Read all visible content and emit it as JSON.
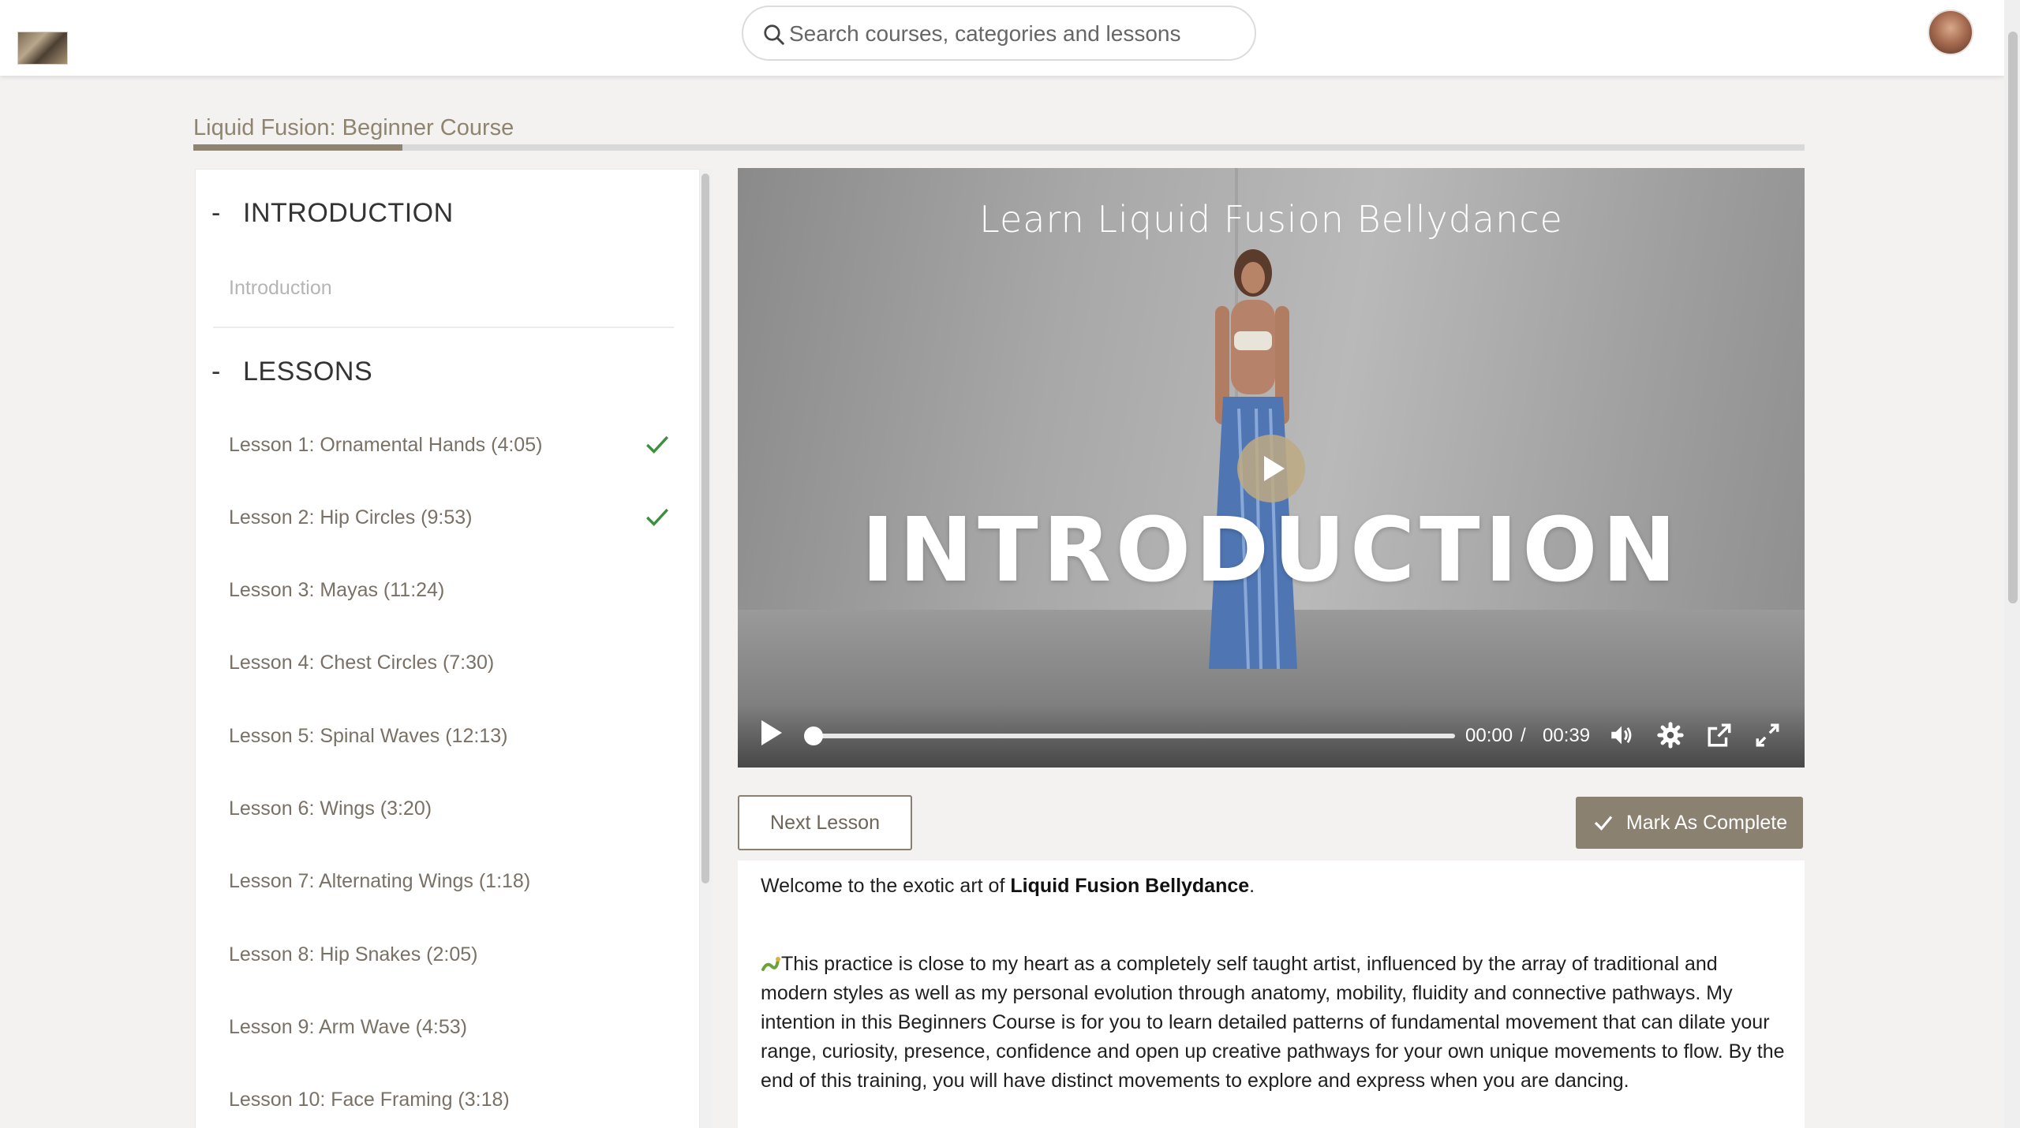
{
  "header": {
    "search_placeholder": "Search courses, categories and lessons"
  },
  "course": {
    "title": "Liquid Fusion: Beginner Course",
    "progress_percent": 13
  },
  "sidebar": {
    "sections": [
      {
        "dash": "-",
        "title": "INTRODUCTION"
      },
      {
        "dash": "-",
        "title": "LESSONS"
      }
    ],
    "intro_item": "Introduction",
    "lessons": [
      {
        "label": "Lesson 1: Ornamental Hands (4:05)",
        "completed": true
      },
      {
        "label": "Lesson 2: Hip Circles (9:53)",
        "completed": true
      },
      {
        "label": "Lesson 3: Mayas (11:24)",
        "completed": false
      },
      {
        "label": "Lesson 4: Chest Circles (7:30)",
        "completed": false
      },
      {
        "label": "Lesson 5: Spinal Waves (12:13)",
        "completed": false
      },
      {
        "label": "Lesson 6: Wings (3:20)",
        "completed": false
      },
      {
        "label": "Lesson 7: Alternating Wings (1:18)",
        "completed": false
      },
      {
        "label": "Lesson 8: Hip Snakes (2:05)",
        "completed": false
      },
      {
        "label": "Lesson 9: Arm Wave (4:53)",
        "completed": false
      },
      {
        "label": "Lesson 10: Face Framing (3:18)",
        "completed": false
      }
    ]
  },
  "video": {
    "heading": "Learn Liquid Fusion Bellydance",
    "overlay_title": "INTRODUCTION",
    "current_time": "00:00",
    "separator": "/",
    "duration": "00:39",
    "progress_fraction": 0
  },
  "actions": {
    "next_label": "Next Lesson",
    "complete_label": "Mark As Complete"
  },
  "description": {
    "intro_prefix": "Welcome to the exotic art of ",
    "intro_bold": "Liquid Fusion Bellydance",
    "intro_suffix": ".",
    "body": "This practice is close to my heart as a completely self taught artist, influenced by the array of traditional and modern styles as well as my personal evolution through anatomy, mobility, fluidity and connective pathways. My intention in this Beginners Course is for you to learn detailed patterns of fundamental movement that can dilate your range, curiosity, presence, confidence and open up creative pathways for your own unique movements to flow. By the end of this training, you will have distinct movements to explore and express when you are dancing."
  },
  "colors": {
    "accent": "#8b8171",
    "check_green": "#3e8e41",
    "title": "#8e846f"
  }
}
